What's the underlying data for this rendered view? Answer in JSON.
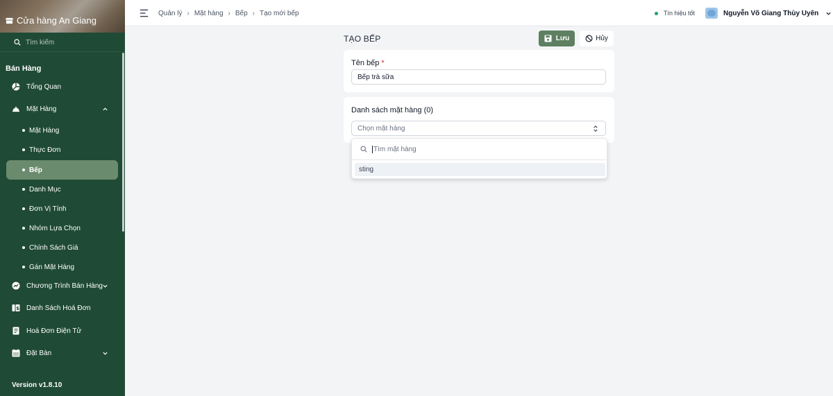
{
  "sidebar": {
    "store_name": "Cửa hàng An Giang",
    "search_placeholder": "Tìm kiếm",
    "section_title": "Bán Hàng",
    "items": [
      {
        "label": "Tổng Quan",
        "icon": "dashboard-icon"
      },
      {
        "label": "Mặt Hàng",
        "icon": "food-tray-icon",
        "expanded": true
      },
      {
        "label": "Chương Trình Bán Hàng",
        "icon": "chart-icon"
      },
      {
        "label": "Danh Sách Hoá Đơn",
        "icon": "invoice-list-icon"
      },
      {
        "label": "Hoá Đơn Điện Tử",
        "icon": "e-invoice-icon"
      },
      {
        "label": "Đặt Bàn",
        "icon": "calendar-icon"
      }
    ],
    "sub_items": [
      "Mặt Hàng",
      "Thực Đơn",
      "Bếp",
      "Danh Mục",
      "Đơn Vị Tính",
      "Nhóm Lựa Chọn",
      "Chính Sách Giá",
      "Gán Mặt Hàng"
    ],
    "active_sub_item": "Bếp",
    "version": "Version v1.8.10"
  },
  "topbar": {
    "breadcrumb": [
      "Quản lý",
      "Mặt hàng",
      "Bếp",
      "Tạo mới bếp"
    ],
    "signal_text": "Tín hiệu tốt",
    "user_name": "Nguyễn Võ Giang Thùy Uyên"
  },
  "form": {
    "page_title": "TẠO BẾP",
    "save_label": "Lưu",
    "cancel_label": "Hủy",
    "name_label": "Tên bếp",
    "required_mark": "*",
    "name_value": "Bếp trà sữa",
    "items_title": "Danh sách mặt hàng (0)",
    "items_select_placeholder": "Chọn mặt hàng",
    "dropdown_search_placeholder": "Tìm mặt hàng",
    "dropdown_options": [
      "sting"
    ]
  },
  "colors": {
    "sidebar_bg": "#1f4a36",
    "accent": "#5e7f61",
    "active_item_bg": "#6a8b6e",
    "signal_good": "#22a06b"
  }
}
